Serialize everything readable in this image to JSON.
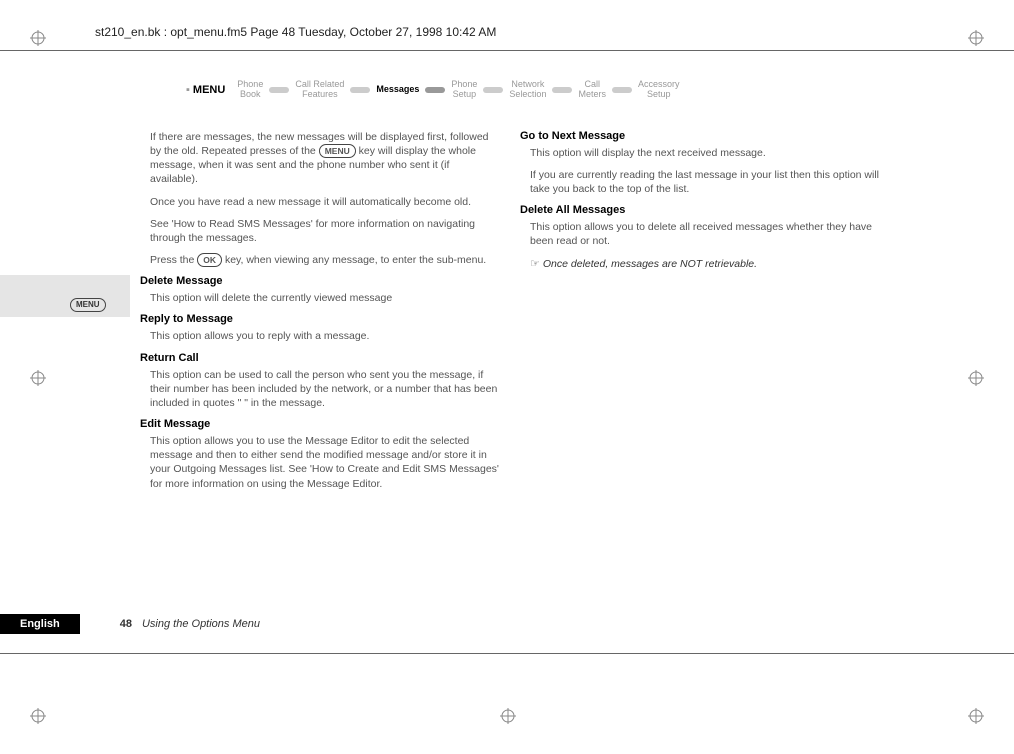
{
  "header": {
    "path": "st210_en.bk : opt_menu.fm5  Page 48  Tuesday, October 27, 1998  10:42 AM"
  },
  "breadcrumb": {
    "menu": "MENU",
    "items": [
      {
        "line1": "Phone",
        "line2": "Book"
      },
      {
        "line1": "Call Related",
        "line2": "Features"
      },
      {
        "line1": "Messages",
        "line2": ""
      },
      {
        "line1": "Phone",
        "line2": "Setup"
      },
      {
        "line1": "Network",
        "line2": "Selection"
      },
      {
        "line1": "Call",
        "line2": "Meters"
      },
      {
        "line1": "Accessory",
        "line2": "Setup"
      }
    ]
  },
  "left": {
    "p1a": "If there are messages, the new messages will be displayed first, followed by the old. Repeated presses of the ",
    "p1_key": "MENU",
    "p1b": " key will display the whole message, when it was sent and the phone number who sent it (if available).",
    "p2": "Once you have read a new message it will automatically become old.",
    "p3": "See 'How to Read SMS Messages' for more information on navigating through the messages.",
    "p4a": "Press the ",
    "p4_key": "OK",
    "p4b": " key, when viewing any message, to enter the sub-menu.",
    "h1": "Delete Message",
    "h1_body": "This option will delete the currently viewed message",
    "h2": "Reply to Message",
    "h2_body": "This option allows you to reply with a message.",
    "h3": "Return Call",
    "h3_body": "This option can be used to call the person who sent you the message, if their number has been included by the network, or a number that has been included in quotes \" \" in the message.",
    "h4": "Edit Message",
    "h4_body": "This option allows you to use the Message Editor to edit the selected message and then to either send the modified message and/or store it in your Outgoing Messages list. See 'How to Create and Edit SMS Messages' for more information on using the Message Editor."
  },
  "right": {
    "h5": "Go to Next Message",
    "h5_b1": "This option will display the next received message.",
    "h5_b2": "If you are currently reading the last message in your list then this option will take you back to the top of the list.",
    "h6": "Delete All Messages",
    "h6_b1": "This option allows you to delete all received messages whether they have been read or not.",
    "note": "Once deleted, messages are NOT retrievable."
  },
  "footer": {
    "lang": "English",
    "page": "48",
    "title": "Using the Options Menu"
  },
  "side_icon": "MENU"
}
